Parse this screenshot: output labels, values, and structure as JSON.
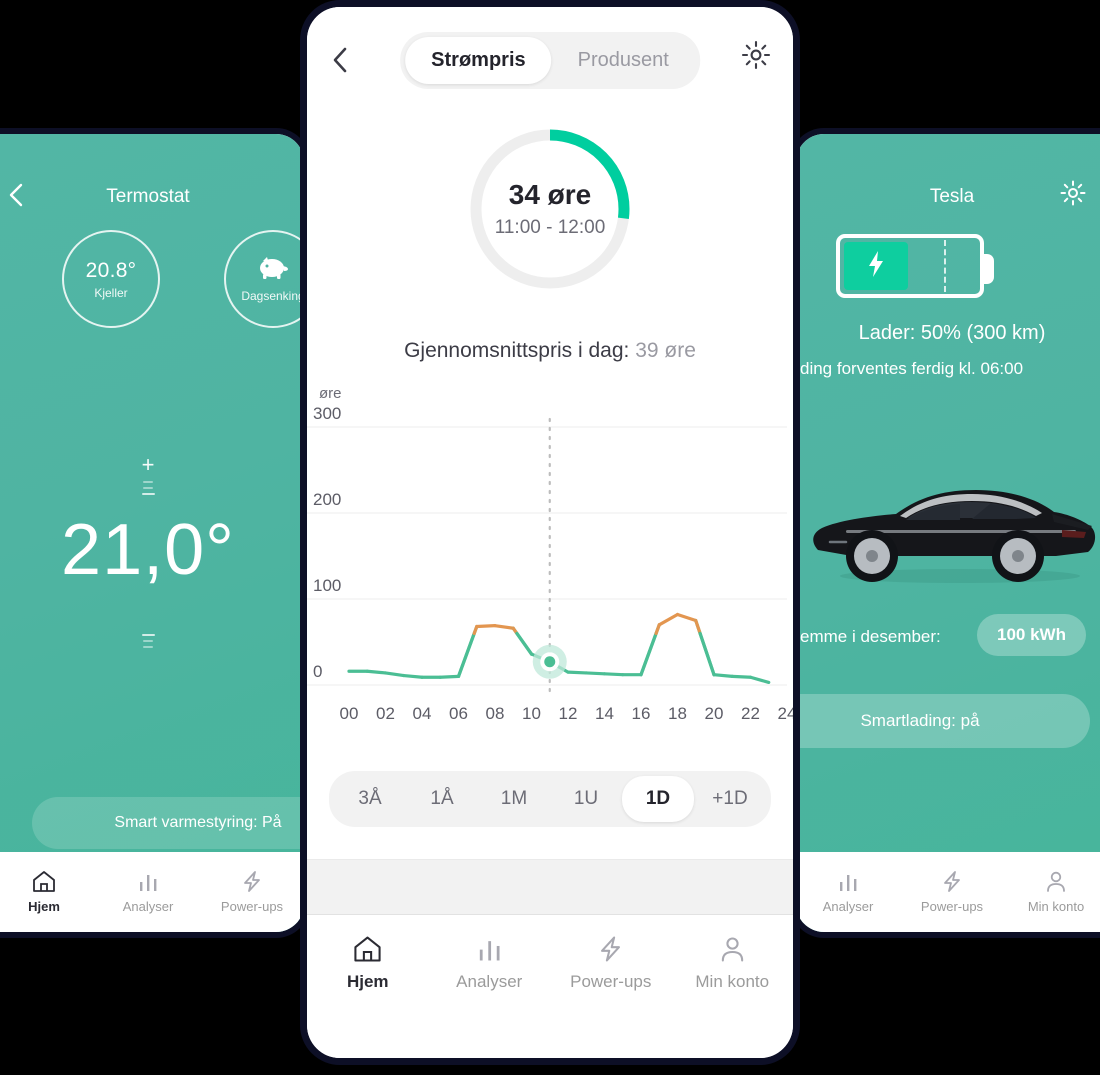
{
  "left_phone": {
    "title": "Termostat",
    "back_icon": "chevron-left-icon",
    "rings": [
      {
        "value": "20.8°",
        "label": "Kjeller"
      },
      {
        "icon": "piggy-bank-icon",
        "label": "Dagsenking"
      }
    ],
    "target_temperature": "21,0°",
    "increase_icon": "plus-icon",
    "decrease_icon": "minus-icon",
    "footer_pill": "Smart varmestyring: På",
    "nav": [
      {
        "label": "Hjem",
        "icon": "home-icon",
        "active": true
      },
      {
        "label": "Analyser",
        "icon": "bar-chart-icon",
        "active": false
      },
      {
        "label": "Power-ups",
        "icon": "bolt-icon",
        "active": false
      }
    ]
  },
  "right_phone": {
    "title": "Tesla",
    "gear_icon": "gear-icon",
    "battery": {
      "icon": "bolt-icon",
      "fill_percent": 46,
      "limit_percent": 74
    },
    "charge_line": "Lader: 50% (300 km)",
    "eta_line": "ding forventes ferdig kl. 06:00",
    "saving_label": "emme i desember:",
    "saving_value": "100 kWh",
    "smart_pill": "Smartlading: på",
    "car_image": "tesla-model-x-side-view",
    "nav": [
      {
        "label": "Analyser",
        "icon": "bar-chart-icon",
        "active": false
      },
      {
        "label": "Power-ups",
        "icon": "bolt-icon",
        "active": false
      },
      {
        "label": "Min konto",
        "icon": "person-icon",
        "active": false
      }
    ]
  },
  "center_phone": {
    "back_icon": "chevron-left-icon",
    "gear_icon": "gear-icon",
    "tabs": [
      {
        "label": "Strømpris",
        "active": true
      },
      {
        "label": "Produsent",
        "active": false
      }
    ],
    "gauge": {
      "price": "34 øre",
      "time_range": "11:00 - 12:00",
      "arc_percent": 27,
      "arc_color": "#00ce9f",
      "track_color": "#eeeeee"
    },
    "average": {
      "label": "Gjennomsnittspris i dag:",
      "value": "39 øre"
    },
    "range_buttons": [
      {
        "label": "3Å",
        "active": false
      },
      {
        "label": "1Å",
        "active": false
      },
      {
        "label": "1M",
        "active": false
      },
      {
        "label": "1U",
        "active": false
      },
      {
        "label": "1D",
        "active": true
      },
      {
        "label": "+1D",
        "active": false
      }
    ],
    "nav": [
      {
        "label": "Hjem",
        "icon": "home-icon",
        "active": true
      },
      {
        "label": "Analyser",
        "icon": "bar-chart-icon",
        "active": false
      },
      {
        "label": "Power-ups",
        "icon": "bolt-icon",
        "active": false
      },
      {
        "label": "Min konto",
        "icon": "person-icon",
        "active": false
      }
    ]
  },
  "chart_data": {
    "type": "line",
    "title": "",
    "xlabel": "",
    "ylabel": "øre",
    "unit": "øre",
    "xlim": [
      0,
      24
    ],
    "ylim": [
      0,
      300
    ],
    "yticks": [
      0,
      100,
      200,
      300
    ],
    "xticks": [
      0,
      2,
      4,
      6,
      8,
      10,
      12,
      14,
      16,
      18,
      20,
      22,
      24
    ],
    "xtick_labels": [
      "00",
      "02",
      "04",
      "06",
      "08",
      "10",
      "12",
      "14",
      "16",
      "18",
      "20",
      "22",
      "24"
    ],
    "grid": true,
    "line_color": "#4bbe94",
    "high_price_color": "#e39650",
    "high_price_threshold": 60,
    "marker": {
      "x": 11,
      "y": 27,
      "color": "#4bbe94",
      "halo_color": "#bfe8da"
    },
    "now_line": {
      "x": 11,
      "style": "dotted",
      "color": "#bdbdbd"
    },
    "x": [
      0,
      1,
      2,
      3,
      4,
      5,
      6,
      7,
      8,
      9,
      10,
      11,
      12,
      13,
      14,
      15,
      16,
      17,
      18,
      19,
      20,
      21,
      22,
      23
    ],
    "values": [
      16,
      16,
      14,
      11,
      9,
      9,
      10,
      68,
      69,
      66,
      36,
      27,
      15,
      14,
      13,
      12,
      12,
      70,
      82,
      75,
      12,
      10,
      9,
      3
    ],
    "series": [
      {
        "name": "Strømpris",
        "values": [
          16,
          16,
          14,
          11,
          9,
          9,
          10,
          68,
          69,
          66,
          36,
          27,
          15,
          14,
          13,
          12,
          12,
          70,
          82,
          75,
          12,
          10,
          9,
          3
        ]
      }
    ]
  }
}
